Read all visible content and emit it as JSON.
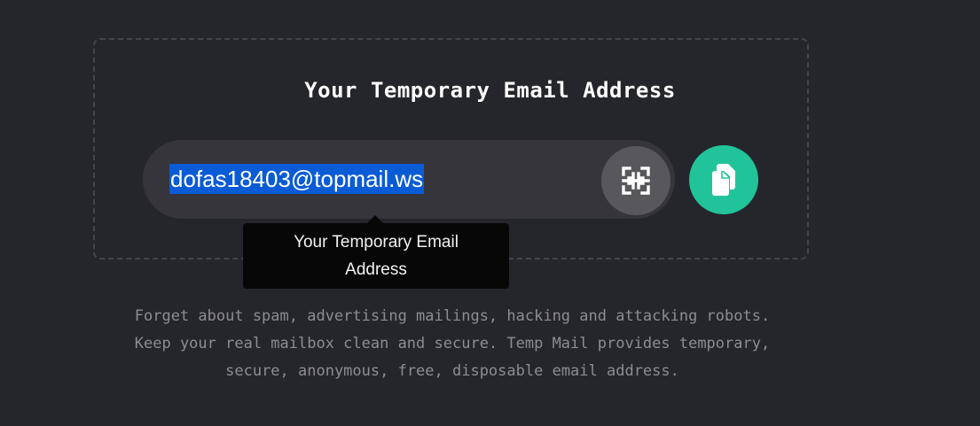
{
  "title": "Your Temporary Email Address",
  "email": {
    "address": "dofas18403@topmail.ws",
    "selected": true
  },
  "buttons": {
    "qr_icon": "qr-code-icon",
    "copy_icon": "copy-icon"
  },
  "tooltip": {
    "line1": "Your Temporary Email",
    "line2": "Address"
  },
  "description": {
    "line1": "Forget about spam, advertising mailings, hacking and attacking robots.",
    "line2": "Keep your real mailbox clean and secure. Temp Mail provides temporary,",
    "line3": "secure, anonymous, free, disposable email address."
  },
  "colors": {
    "background": "#25252c",
    "accent": "#21c49a",
    "selection": "#0a5bd6"
  }
}
